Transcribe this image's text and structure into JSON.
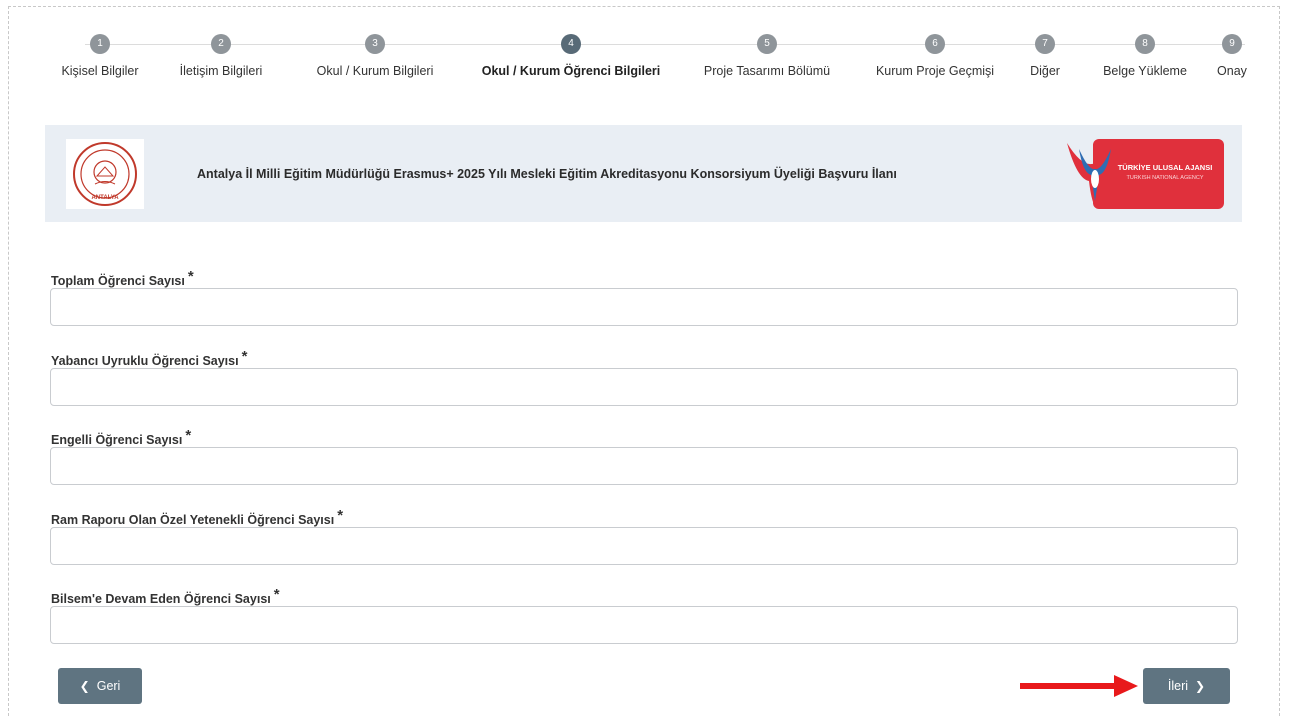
{
  "stepper": {
    "steps": [
      {
        "number": "1",
        "label": "Kişisel Bilgiler"
      },
      {
        "number": "2",
        "label": "İletişim Bilgileri"
      },
      {
        "number": "3",
        "label": "Okul / Kurum Bilgileri"
      },
      {
        "number": "4",
        "label": "Okul / Kurum Öğrenci Bilgileri"
      },
      {
        "number": "5",
        "label": "Proje Tasarımı Bölümü"
      },
      {
        "number": "6",
        "label": "Kurum Proje Geçmişi"
      },
      {
        "number": "7",
        "label": "Diğer"
      },
      {
        "number": "8",
        "label": "Belge Yükleme"
      },
      {
        "number": "9",
        "label": "Onay"
      }
    ],
    "active_step": "4"
  },
  "banner": {
    "title": "Antalya İl Milli Eğitim Müdürlüğü Erasmus+ 2025 Yılı Mesleki Eğitim Akreditasyonu Konsorsiyum Üyeliği Başvuru İlanı",
    "left_logo_text": "ANTALYA",
    "right_logo_line1": "TÜRKİYE ULUSAL AJANSI",
    "right_logo_line2": "TURKISH NATIONAL AGENCY"
  },
  "form": {
    "required_mark": "*",
    "fields": [
      {
        "label": "Toplam Öğrenci Sayısı",
        "value": ""
      },
      {
        "label": "Yabancı Uyruklu Öğrenci Sayısı",
        "value": ""
      },
      {
        "label": "Engelli Öğrenci Sayısı",
        "value": ""
      },
      {
        "label": "Ram Raporu Olan Özel Yetenekli Öğrenci Sayısı",
        "value": ""
      },
      {
        "label": "Bilsem'e Devam Eden Öğrenci Sayısı",
        "value": ""
      }
    ]
  },
  "buttons": {
    "back_label": "Geri",
    "next_label": "İleri"
  },
  "colors": {
    "step_inactive": "#8f959a",
    "step_active": "#586a77",
    "button": "#5f7481",
    "banner_bg": "#e9eef4",
    "annotation_arrow": "#e8191b"
  }
}
